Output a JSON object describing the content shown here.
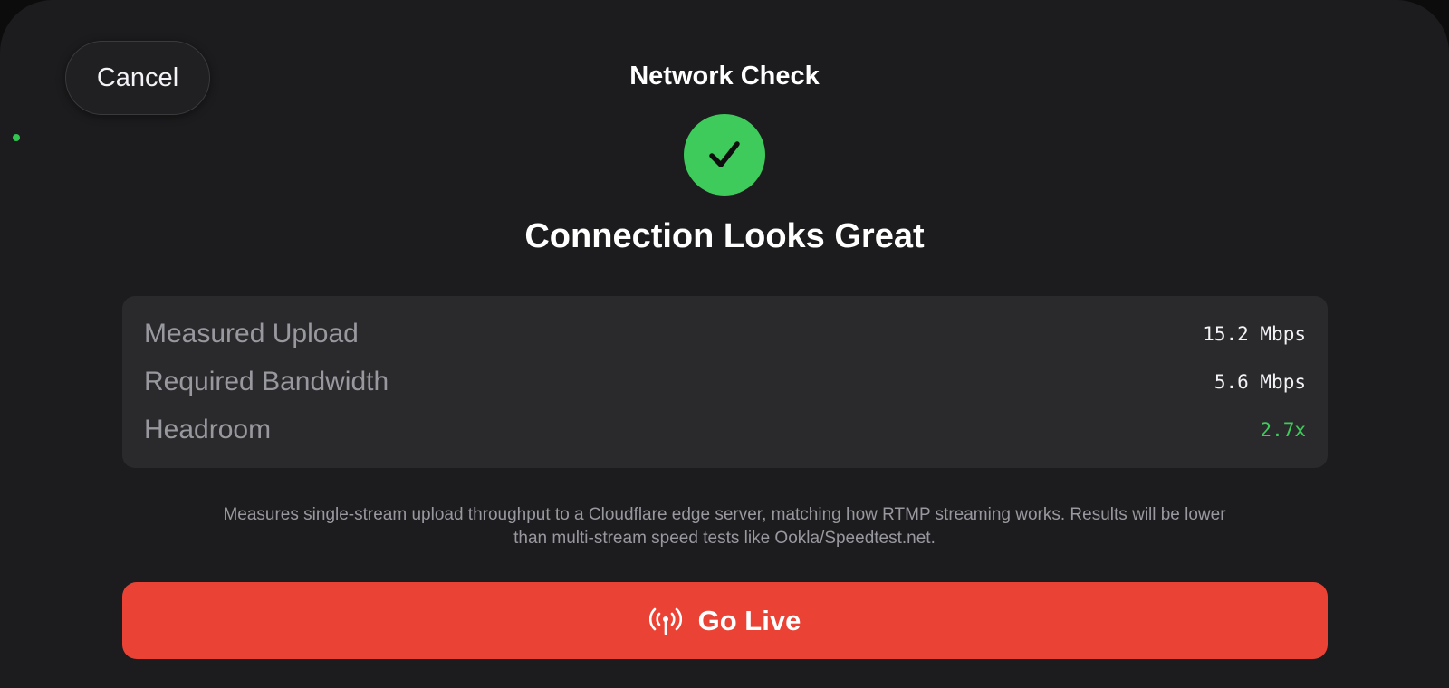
{
  "header": {
    "cancel_label": "Cancel",
    "title": "Network Check"
  },
  "result": {
    "icon": "checkmark-icon",
    "headline": "Connection Looks Great"
  },
  "stats": [
    {
      "label": "Measured Upload",
      "value": "15.2 Mbps"
    },
    {
      "label": "Required Bandwidth",
      "value": "5.6 Mbps"
    },
    {
      "label": "Headroom",
      "value": "2.7x"
    }
  ],
  "footnote": {
    "line1": "Measures single-stream upload throughput to a Cloudflare edge server, matching how RTMP streaming works. Results will be lower",
    "line2": "than multi-stream speed tests like Ookla/Speedtest.net."
  },
  "action": {
    "icon": "antenna-broadcast-icon",
    "label": "Go Live"
  },
  "colors": {
    "background": "#1c1c1e",
    "card": "#2a2a2c",
    "success": "#3fcb5b",
    "primary_action": "#ea4335"
  }
}
